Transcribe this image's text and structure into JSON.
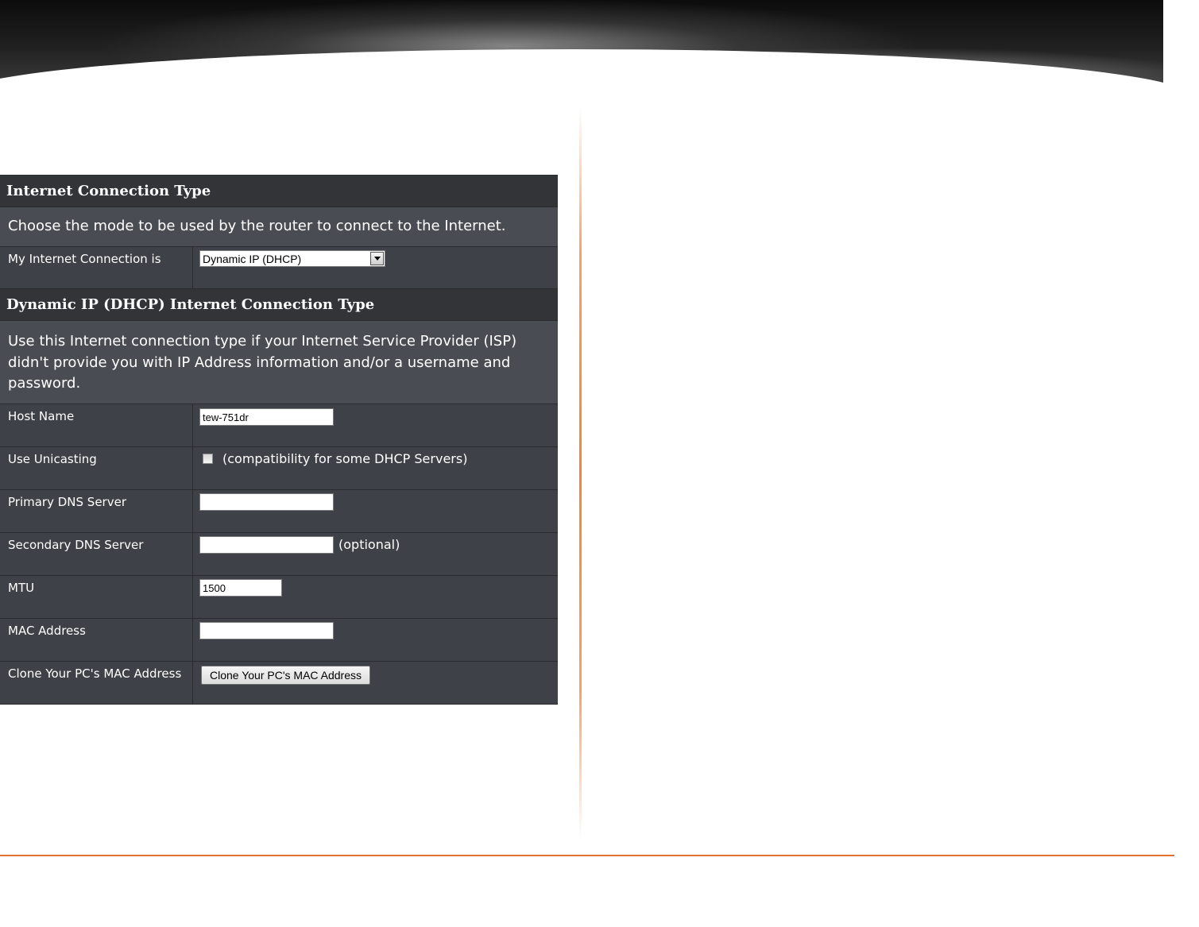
{
  "section1": {
    "title": "Internet Connection Type",
    "description": "Choose the mode to be used by the router to connect to the Internet.",
    "connection_label": "My Internet Connection is",
    "connection_value": "Dynamic IP (DHCP)"
  },
  "section2": {
    "title": "Dynamic IP (DHCP) Internet Connection Type",
    "description": "Use this Internet connection type if your Internet Service Provider (ISP) didn't provide you with IP Address information and/or a username and password."
  },
  "fields": {
    "host_name": {
      "label": "Host Name",
      "value": "tew-751dr"
    },
    "unicasting": {
      "label": "Use Unicasting",
      "note": "(compatibility for some DHCP Servers)",
      "checked": false
    },
    "primary_dns": {
      "label": "Primary DNS Server",
      "value": ""
    },
    "secondary_dns": {
      "label": "Secondary DNS Server",
      "value": "",
      "note": "(optional)"
    },
    "mtu": {
      "label": "MTU",
      "value": "1500"
    },
    "mac_address": {
      "label": "MAC Address",
      "value": ""
    },
    "clone_mac": {
      "label": "Clone Your PC's MAC Address",
      "button_label": "Clone Your PC's MAC Address"
    }
  },
  "colors": {
    "accent": "#e2712f",
    "panel_bg": "#3f4148",
    "header_bg": "#333438"
  }
}
